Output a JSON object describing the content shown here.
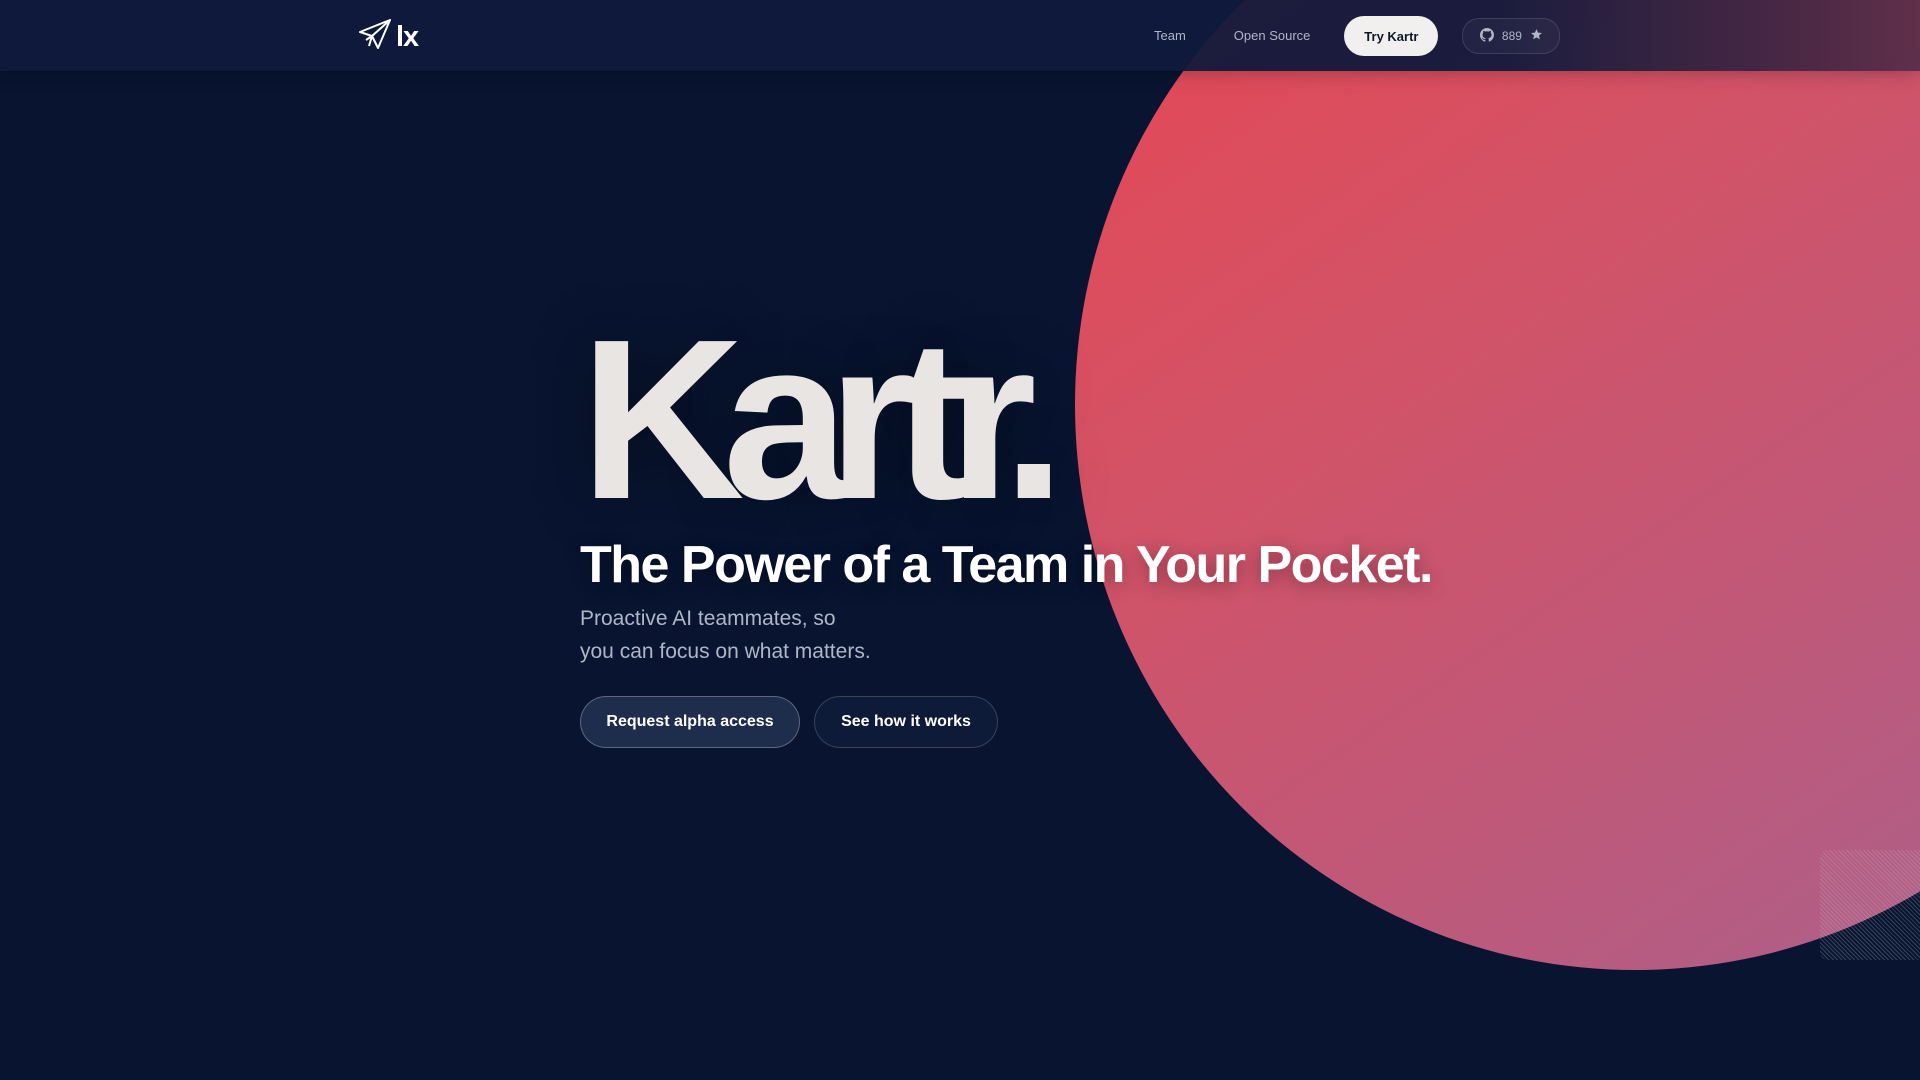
{
  "brand": {
    "logo_text": "lx",
    "logo_icon": "paper-plane-icon"
  },
  "nav": {
    "links": [
      "Team",
      "Open Source"
    ],
    "cta_label": "Try Kartr",
    "github": {
      "icon": "github-icon",
      "stars": "889",
      "star_icon": "star-icon"
    }
  },
  "hero": {
    "title": "Kartr.",
    "tagline": "The Power of a Team in Your Pocket.",
    "subtext_line1": "Proactive AI teammates, so",
    "subtext_line2": "you can focus on what matters.",
    "primary_cta": "Request alpha access",
    "secondary_cta": "See how it works"
  },
  "colors": {
    "background": "#081430",
    "orb_start": "#ea4450",
    "orb_end": "#a8628f",
    "title_text": "#e8e5e2"
  }
}
